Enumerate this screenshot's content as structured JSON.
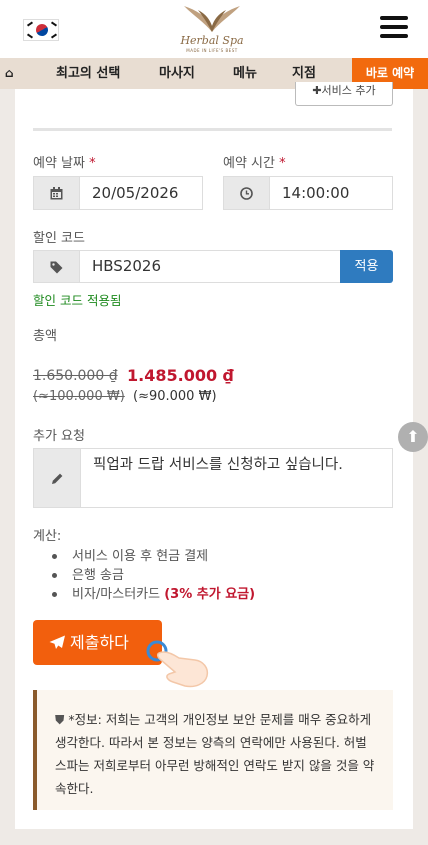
{
  "header": {
    "flag_icon": "south-korea-flag-icon",
    "logo": {
      "brand": "Herbal Spa",
      "tagline": "MADE IN LIFE'S BEST"
    },
    "menu_icon": "hamburger-icon"
  },
  "nav": {
    "home_icon": "⌂",
    "items": [
      "최고의 선택",
      "마사지",
      "메뉴",
      "지점"
    ],
    "cta": "바로 예약",
    "colors": {
      "nav_bg": "#e8ddd2",
      "cta_bg": "#f26a0e"
    }
  },
  "form": {
    "add_service": "서비스 추가",
    "date_label": "예약 날짜",
    "date_value": "20/05/2026",
    "time_label": "예약 시간",
    "time_value": "14:00:00",
    "required_mark": "*",
    "promo_label": "할인 코드",
    "promo_value": "HBS2026",
    "apply_label": "적용",
    "promo_ok": "할인 코드 적용됨",
    "total_label": "총액",
    "price_old": "1.650.000 ₫",
    "price_new": "1.485.000 ₫",
    "krw_old": "(≈100.000 ₩)",
    "krw_new": "(≈90.000 ₩)",
    "request_label": "추가 요청",
    "request_value": "픽업과 드랍 서비스를 신청하고 싶습니다.",
    "calc_label": "계산:",
    "calc_items": [
      "서비스 이용 후 현금 결제",
      "은행 송금",
      "비자/마스터카드 "
    ],
    "calc_extra": "(3% 추가 요금)",
    "submit_label": "제출하다",
    "notice": "*정보: 저희는 고객의 개인정보 보안 문제를 매우 중요하게 생각한다. 따라서 본 정보는 양측의 연락에만 사용된다. 허벌 스파는 저희로부터 아무런 방해적인 연락도 받지 않을 것을 약속한다.",
    "colors": {
      "required": "#c0172f",
      "apply": "#2f7bbf",
      "submit": "#f25f0d",
      "success": "#1e8a1e"
    }
  }
}
